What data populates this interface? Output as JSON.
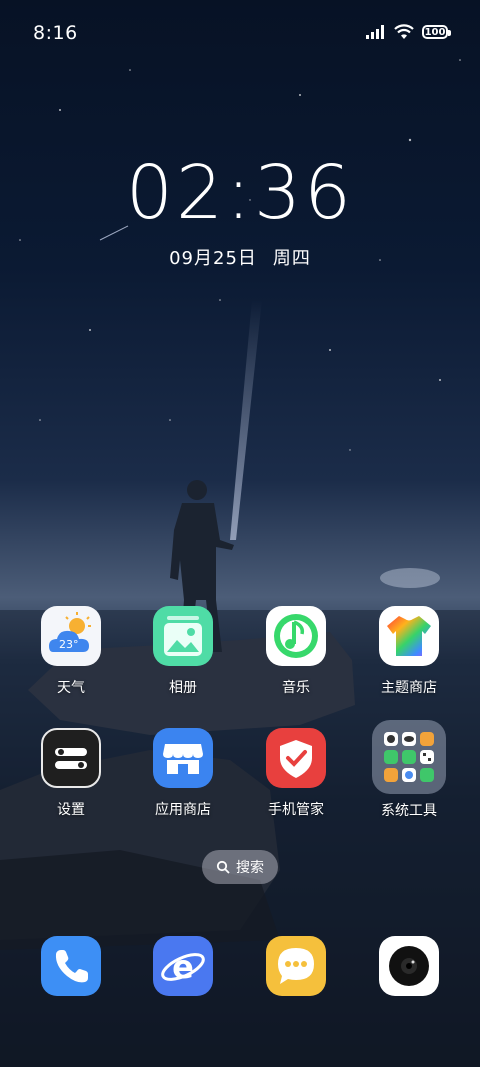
{
  "status_bar": {
    "time": "8:16",
    "battery_level": "100",
    "icons": [
      "signal-icon",
      "wifi-icon",
      "battery-icon"
    ]
  },
  "lockscreen_widget": {
    "time": "02:36",
    "date": "09月25日",
    "weekday": "周四"
  },
  "apps": [
    {
      "label": "天气",
      "icon": "weather-icon",
      "temp": "23°"
    },
    {
      "label": "相册",
      "icon": "gallery-icon"
    },
    {
      "label": "音乐",
      "icon": "music-icon"
    },
    {
      "label": "主题商店",
      "icon": "theme-store-icon"
    },
    {
      "label": "设置",
      "icon": "settings-icon"
    },
    {
      "label": "应用商店",
      "icon": "app-store-icon"
    },
    {
      "label": "手机管家",
      "icon": "phone-manager-icon"
    },
    {
      "label": "系统工具",
      "icon": "system-tools-folder-icon"
    }
  ],
  "search": {
    "label": "搜索"
  },
  "dock": [
    {
      "icon": "phone-icon"
    },
    {
      "icon": "browser-icon"
    },
    {
      "icon": "messages-icon"
    },
    {
      "icon": "camera-icon"
    }
  ],
  "colors": {
    "phone": "#3d8ff5",
    "browser": "#4a78f0",
    "messages": "#f5c03c",
    "gallery": "#4fdca6",
    "app_store": "#3b84f0",
    "phone_manager": "#e8403e"
  }
}
